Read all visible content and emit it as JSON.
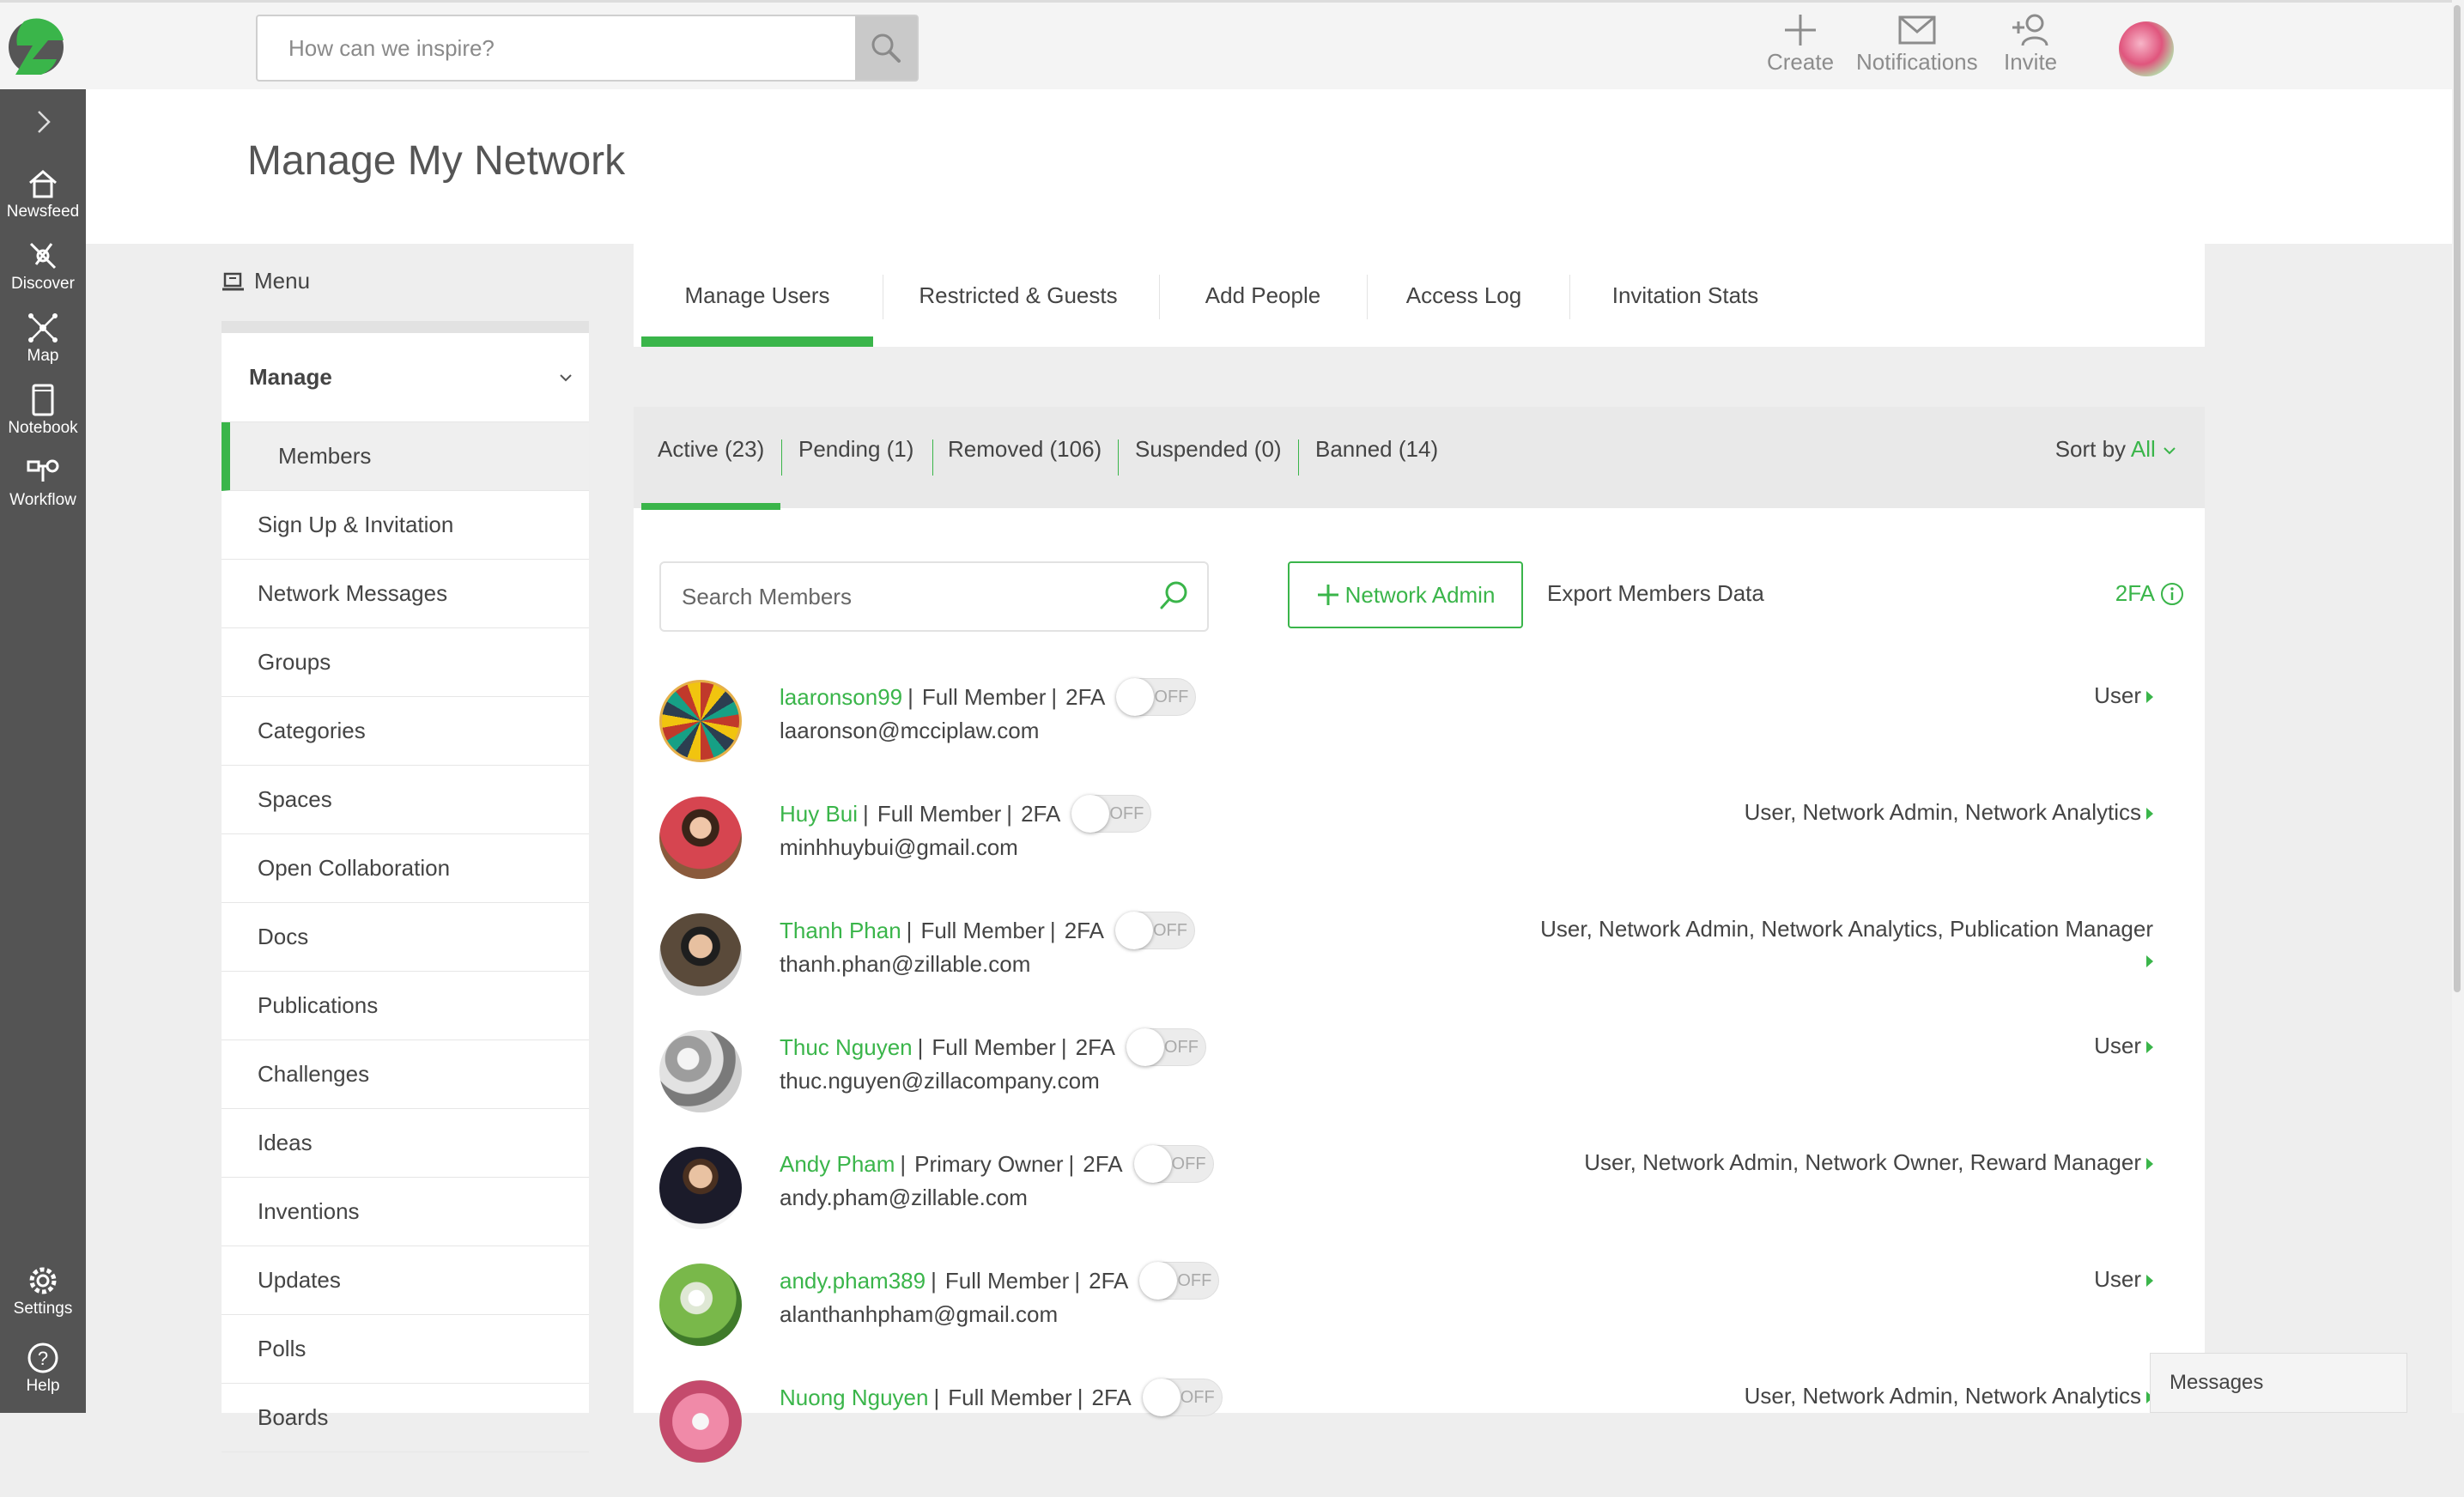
{
  "top": {
    "search_placeholder": "How can we inspire?",
    "actions": {
      "create": "Create",
      "notifications": "Notifications",
      "invite": "Invite"
    }
  },
  "rail": {
    "items": [
      "Newsfeed",
      "Discover",
      "Map",
      "Notebook",
      "Workflow"
    ],
    "bottom": [
      "Settings",
      "Help"
    ]
  },
  "page": {
    "title": "Manage My Network"
  },
  "menu": {
    "caption": "Menu",
    "section": "Manage",
    "items": [
      "Members",
      "Sign Up & Invitation",
      "Network Messages",
      "Groups",
      "Categories",
      "Spaces",
      "Open Collaboration",
      "Docs",
      "Publications",
      "Challenges",
      "Ideas",
      "Inventions",
      "Updates",
      "Polls",
      "Boards"
    ]
  },
  "tabs": [
    "Manage Users",
    "Restricted & Guests",
    "Add People",
    "Access Log",
    "Invitation Stats"
  ],
  "filters": [
    "Active (23)",
    "Pending (1)",
    "Removed (106)",
    "Suspended (0)",
    "Banned (14)"
  ],
  "sort": {
    "label": "Sort by",
    "value": "All"
  },
  "toolbar": {
    "search_placeholder": "Search Members",
    "admin_button": "Network Admin",
    "export": "Export Members Data",
    "twofa": "2FA"
  },
  "twofa_label": "2FA",
  "toggle_off": "OFF",
  "members": [
    {
      "name": "laaronson99",
      "type": "Full Member",
      "email": "laaronson@mcciplaw.com",
      "roles": "User"
    },
    {
      "name": "Huy Bui",
      "type": "Full Member",
      "email": "minhhuybui@gmail.com",
      "roles": "User, Network Admin, Network Analytics"
    },
    {
      "name": "Thanh Phan",
      "type": "Full Member",
      "email": "thanh.phan@zillable.com",
      "roles": "User, Network Admin, Network Analytics, Publication Manager"
    },
    {
      "name": "Thuc Nguyen",
      "type": "Full Member",
      "email": "thuc.nguyen@zillacompany.com",
      "roles": "User"
    },
    {
      "name": "Andy Pham",
      "type": "Primary Owner",
      "email": "andy.pham@zillable.com",
      "roles": "User, Network Admin, Network Owner, Reward Manager"
    },
    {
      "name": "andy.pham389",
      "type": "Full Member",
      "email": "alanthanhpham@gmail.com",
      "roles": "User"
    },
    {
      "name": "Nuong Nguyen",
      "type": "Full Member",
      "email": "",
      "roles": "User, Network Admin, Network Analytics"
    }
  ],
  "messages": "Messages",
  "colors": {
    "accent": "#3ab54a",
    "rail": "#545454"
  }
}
